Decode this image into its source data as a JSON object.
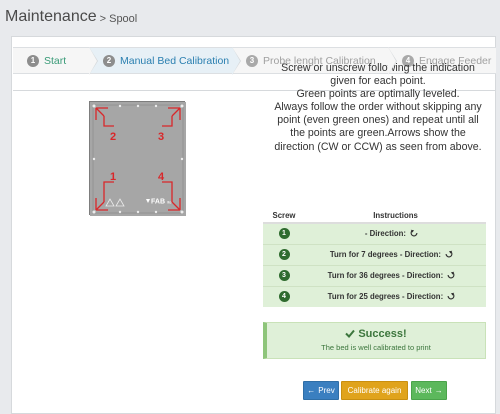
{
  "header": {
    "title": "Maintenance",
    "breadcrumb": "> Spool"
  },
  "wizard": {
    "steps": [
      {
        "num": "1",
        "label": "Start"
      },
      {
        "num": "2",
        "label": "Manual Bed Calibration"
      },
      {
        "num": "3",
        "label": "Probe lenght Calibration"
      },
      {
        "num": "4",
        "label": "Engage Feeder"
      }
    ]
  },
  "bed": {
    "labels": [
      "2",
      "3",
      "1",
      "4"
    ],
    "brand": "FAB",
    "brand_suffix": "lite"
  },
  "instructions": {
    "lines": [
      "Screw or unscrew following the indication",
      "given for each point.",
      "Green points are optimally leveled.",
      "Always follow the order without skipping any",
      "point (even green ones) and repeat until all",
      "the points are green.Arrows show the",
      "direction (CW or CCW) as seen from above."
    ]
  },
  "table": {
    "col_screw": "Screw",
    "col_instructions": "Instructions",
    "rows": [
      {
        "screw": "1",
        "instruction": "- Direction:",
        "icon": "ccw-arrow-icon"
      },
      {
        "screw": "2",
        "instruction": "Turn for 7 degrees - Direction:",
        "icon": "cw-arrow-icon"
      },
      {
        "screw": "3",
        "instruction": "Turn for 36 degrees - Direction:",
        "icon": "cw-arrow-icon"
      },
      {
        "screw": "4",
        "instruction": "Turn for 25 degrees - Direction:",
        "icon": "cw-arrow-icon"
      }
    ]
  },
  "result": {
    "title": "Success!",
    "message": "The bed is well calibrated to print"
  },
  "buttons": {
    "prev": "Prev",
    "calibrate": "Calibrate again",
    "next": "Next"
  },
  "colors": {
    "primary": "#3a7fc0",
    "warning": "#e0a31c",
    "success": "#5cb85c",
    "success_bg": "#dff0d8",
    "bed_marker": "#d9272a"
  }
}
